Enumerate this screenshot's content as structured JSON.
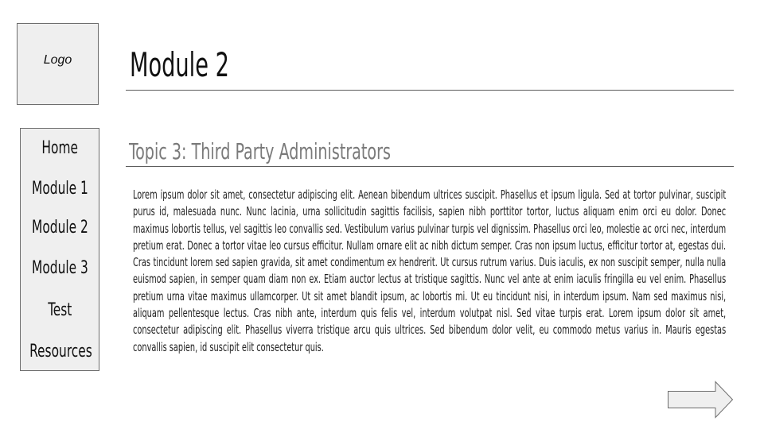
{
  "logo": {
    "label": "Logo"
  },
  "header": {
    "title": "Module 2"
  },
  "sidebar": {
    "items": [
      {
        "label": "Home"
      },
      {
        "label": "Module 1"
      },
      {
        "label": "Module 2"
      },
      {
        "label": "Module 3"
      },
      {
        "label": "Test"
      },
      {
        "label": "Resources"
      }
    ]
  },
  "content": {
    "topic_title": "Topic 3: Third Party Administrators",
    "body": "Lorem ipsum dolor sit amet, consectetur adipiscing elit. Aenean bibendum ultrices suscipit. Phasellus et ipsum ligula. Sed at tortor pulvinar, suscipit purus id, malesuada nunc. Nunc lacinia, urna sollicitudin sagittis facilisis, sapien nibh porttitor tortor, luctus aliquam enim orci eu dolor. Donec maximus lobortis tellus, vel sagittis leo convallis sed. Vestibulum varius pulvinar turpis vel dignissim. Phasellus orci leo, molestie ac orci nec, interdum pretium erat. Donec a tortor vitae leo cursus efficitur. Nullam ornare elit ac nibh dictum semper. Cras non ipsum luctus, efficitur tortor at, egestas dui. Cras tincidunt lorem sed sapien gravida, sit amet condimentum ex hendrerit. Ut cursus rutrum varius. Duis iaculis, ex non suscipit semper, nulla nulla euismod sapien, in semper quam diam non ex. Etiam auctor lectus at tristique sagittis. Nunc vel ante at enim iaculis fringilla eu vel enim. Phasellus pretium urna vitae maximus ullamcorper. Ut sit amet blandit ipsum, ac lobortis mi. Ut eu tincidunt nisi, in interdum ipsum. Nam sed maximus nisi, aliquam pellentesque lectus. Cras nibh ante, interdum quis felis vel, interdum volutpat nisl. Sed vitae turpis erat. Lorem ipsum dolor sit amet, consectetur adipiscing elit. Phasellus viverra tristique arcu quis ultrices. Sed bibendum dolor velit, eu commodo metus varius in. Mauris egestas convallis sapien, id suscipit elit consectetur quis."
  },
  "navigation": {
    "next_icon": "right-arrow-icon"
  },
  "colors": {
    "panel_fill": "#efefef",
    "panel_border": "#6d6d6d",
    "rule": "#5a5a5a",
    "topic_text": "#7a7a7a"
  }
}
